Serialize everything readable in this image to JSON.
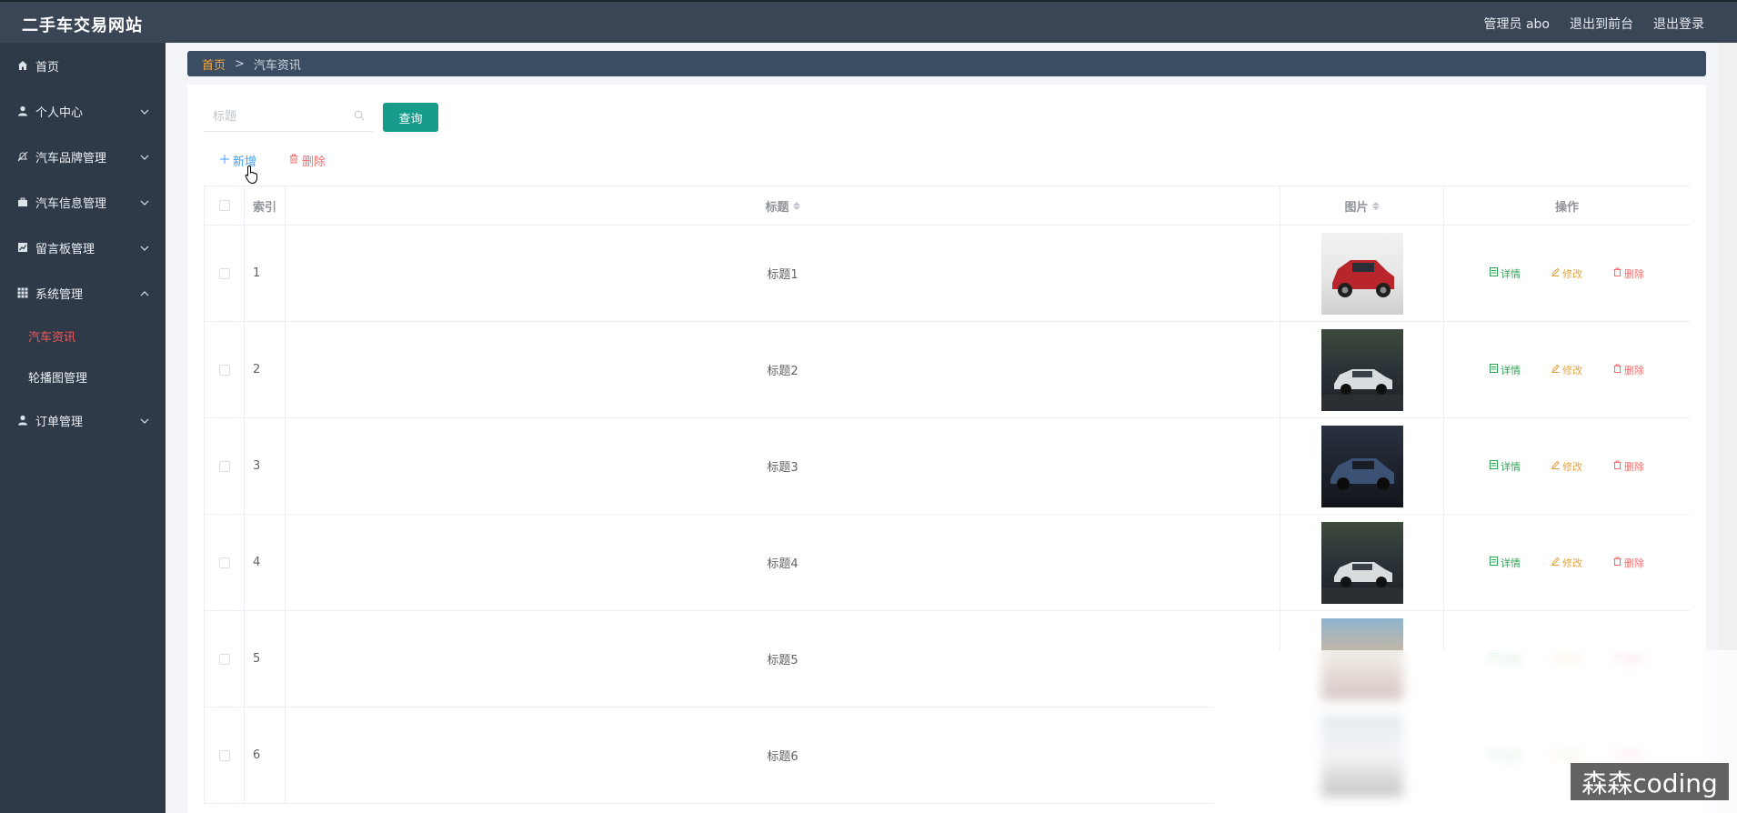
{
  "app": {
    "title": "二手车交易网站"
  },
  "header": {
    "links": [
      "管理员 abo",
      "退出到前台",
      "退出登录"
    ]
  },
  "sidebar": {
    "items": [
      {
        "label": "首页",
        "icon": "home-icon",
        "chevron": ""
      },
      {
        "label": "个人中心",
        "icon": "user-icon",
        "chevron": "down"
      },
      {
        "label": "汽车品牌管理",
        "icon": "bell-icon",
        "chevron": "down"
      },
      {
        "label": "汽车信息管理",
        "icon": "briefcase-icon",
        "chevron": "down"
      },
      {
        "label": "留言板管理",
        "icon": "chart-icon",
        "chevron": "down"
      },
      {
        "label": "系统管理",
        "icon": "grid-icon",
        "chevron": "up"
      },
      {
        "label": "订单管理",
        "icon": "user-icon",
        "chevron": "down"
      }
    ],
    "subitems": [
      {
        "label": "汽车资讯",
        "active": true
      },
      {
        "label": "轮播图管理",
        "active": false
      }
    ]
  },
  "breadcrumb": {
    "home": "首页",
    "separator": ">",
    "current": "汽车资讯"
  },
  "search": {
    "placeholder": "标题",
    "button": "查询"
  },
  "toolbar": {
    "add": "新增",
    "delete": "删除"
  },
  "table": {
    "headers": {
      "index": "索引",
      "title": "标题",
      "image": "图片",
      "actions": "操作"
    },
    "rows": [
      {
        "index": "1",
        "title": "标题1",
        "image": "red-suv"
      },
      {
        "index": "2",
        "title": "标题2",
        "image": "silver-sedan-street"
      },
      {
        "index": "3",
        "title": "标题3",
        "image": "blue-crossover"
      },
      {
        "index": "4",
        "title": "标题4",
        "image": "silver-sedan-street"
      },
      {
        "index": "5",
        "title": "标题5",
        "image": "car-blurred"
      },
      {
        "index": "6",
        "title": "标题6",
        "image": "car-blurred"
      }
    ],
    "actions": {
      "detail": "详情",
      "edit": "修改",
      "remove": "删除"
    }
  },
  "watermark": "森森coding",
  "colors": {
    "topbar": "#3a4556",
    "sidebar": "#2f3a49",
    "active_menu": "#f45858",
    "query_button": "#179c8b",
    "breadcrumb": "#3b4d63",
    "breadcrumb_home": "#f4a53a",
    "detail": "#2fa454",
    "edit": "#e6a23c",
    "remove": "#f56c6c",
    "add": "#409eff"
  }
}
